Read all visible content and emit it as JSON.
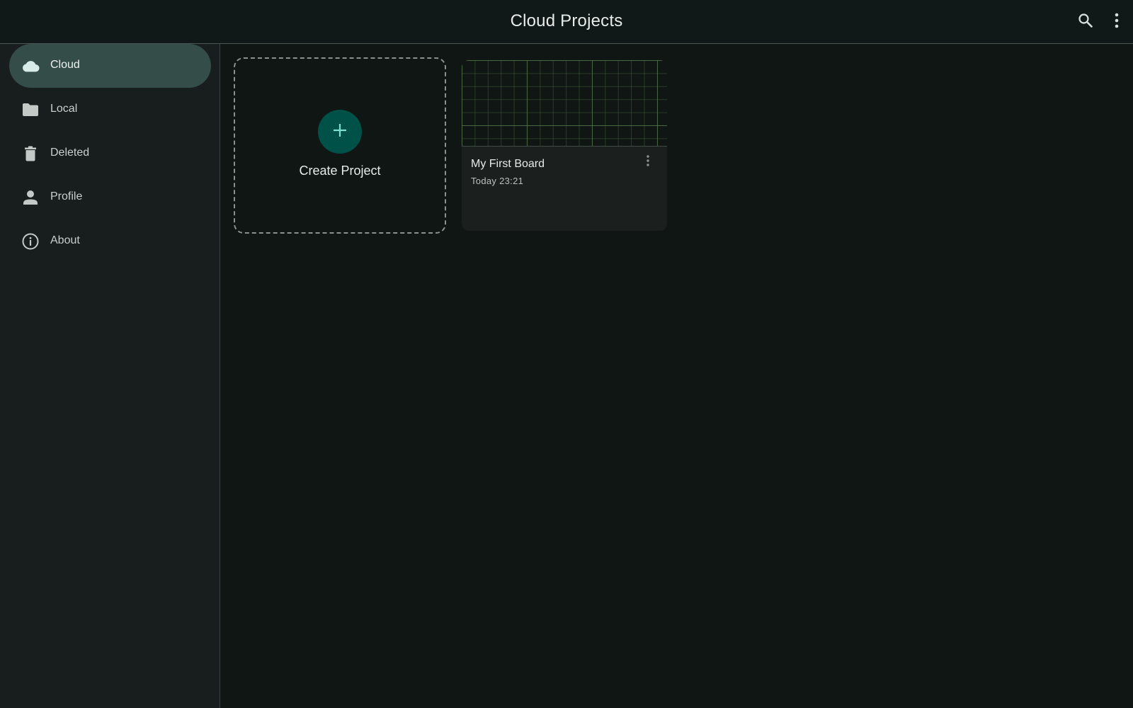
{
  "header": {
    "title": "Cloud Projects",
    "search_icon": "search-icon",
    "more_icon": "more-vert-icon"
  },
  "sidebar": {
    "items": [
      {
        "label": "Cloud",
        "icon": "cloud-icon",
        "active": true
      },
      {
        "label": "Local",
        "icon": "folder-icon",
        "active": false
      },
      {
        "label": "Deleted",
        "icon": "trash-icon",
        "active": false
      },
      {
        "label": "Profile",
        "icon": "person-icon",
        "active": false
      },
      {
        "label": "About",
        "icon": "info-icon",
        "active": false
      }
    ]
  },
  "main": {
    "create_card": {
      "label": "Create Project",
      "icon": "plus-icon"
    },
    "projects": [
      {
        "title": "My First Board",
        "modified": "Today 23:21",
        "menu_icon": "more-vert-icon"
      }
    ]
  },
  "colors": {
    "background": "#0f1614",
    "sidebar_background": "#181e1d",
    "active_nav": "#344d48",
    "fab": "#005148",
    "accent": "#7fe0cf"
  }
}
